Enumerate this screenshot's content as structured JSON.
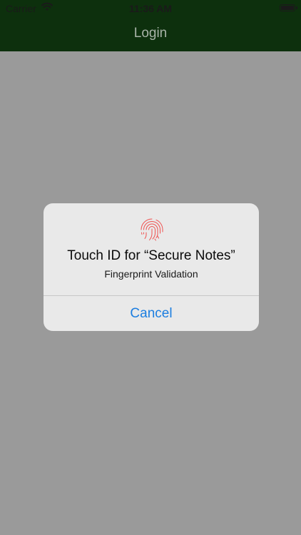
{
  "status_bar": {
    "carrier": "Carrier",
    "time": "11:36 AM"
  },
  "nav": {
    "title": "Login"
  },
  "alert": {
    "title": "Touch ID for “Secure Notes”",
    "message": "Fingerprint Validation",
    "cancel_label": "Cancel",
    "icon": "fingerprint-icon"
  },
  "colors": {
    "nav_background": "#0d300d",
    "overlay_background": "#9a9a9a",
    "alert_background": "#e9e9e9",
    "fingerprint": "#f0504f",
    "button_text": "#1c7ee0"
  }
}
